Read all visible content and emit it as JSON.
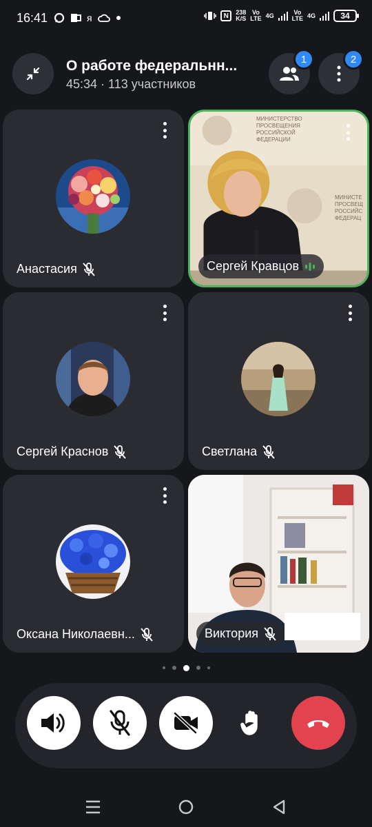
{
  "status_bar": {
    "time": "16:41",
    "left_icons": [
      "chat-icon",
      "office-icon",
      "yandex-icon",
      "cloud-icon",
      "dot-icon"
    ],
    "yandex_glyph": "я",
    "net_speed": "238",
    "net_speed_unit": "K/S",
    "sim1_label": "Vo",
    "sim1_sub": "LTE",
    "net1": "4G",
    "sim2_label": "Vo",
    "sim2_sub": "LTE",
    "net2": "4G",
    "battery": "34"
  },
  "header": {
    "title": "О работе федеральнн...",
    "duration": "45:34",
    "participants_text": "113 участников",
    "participants_badge": "1",
    "menu_badge": "2"
  },
  "tiles": [
    {
      "name": "Анастасия",
      "muted": true,
      "type": "avatar"
    },
    {
      "name": "Сергей Кравцов",
      "muted": false,
      "speaking": true,
      "type": "video"
    },
    {
      "name": "Сергей Краснов",
      "muted": true,
      "type": "avatar"
    },
    {
      "name": "Светлана",
      "muted": true,
      "type": "avatar"
    },
    {
      "name": "Оксана Николаевн...",
      "muted": true,
      "type": "avatar"
    },
    {
      "name": "Виктория",
      "muted": true,
      "type": "video"
    }
  ],
  "video_text": {
    "ministry_line1": "МИНИСТЕРСТВО",
    "ministry_line2": "ПРОСВЕЩЕНИЯ",
    "ministry_line3": "РОССИЙСКОЙ",
    "ministry_line4": "ФЕДЕРАЦИИ",
    "ministry_b_line1": "МИНИСТЕ",
    "ministry_b_line2": "ПРОСВЕЩ",
    "ministry_b_line3": "РОССИЙС",
    "ministry_b_line4": "ФЕДЕРАЦ"
  },
  "pager": {
    "pages": 5,
    "current": 3
  },
  "controls": [
    "speaker-icon",
    "mic-off-icon",
    "camera-off-icon",
    "raise-hand-icon",
    "end-call-icon"
  ],
  "colors": {
    "accent": "#2f8af5",
    "end_call": "#e2434f",
    "speaking_border": "#4ab35b",
    "tile_bg": "#2b2c31"
  }
}
